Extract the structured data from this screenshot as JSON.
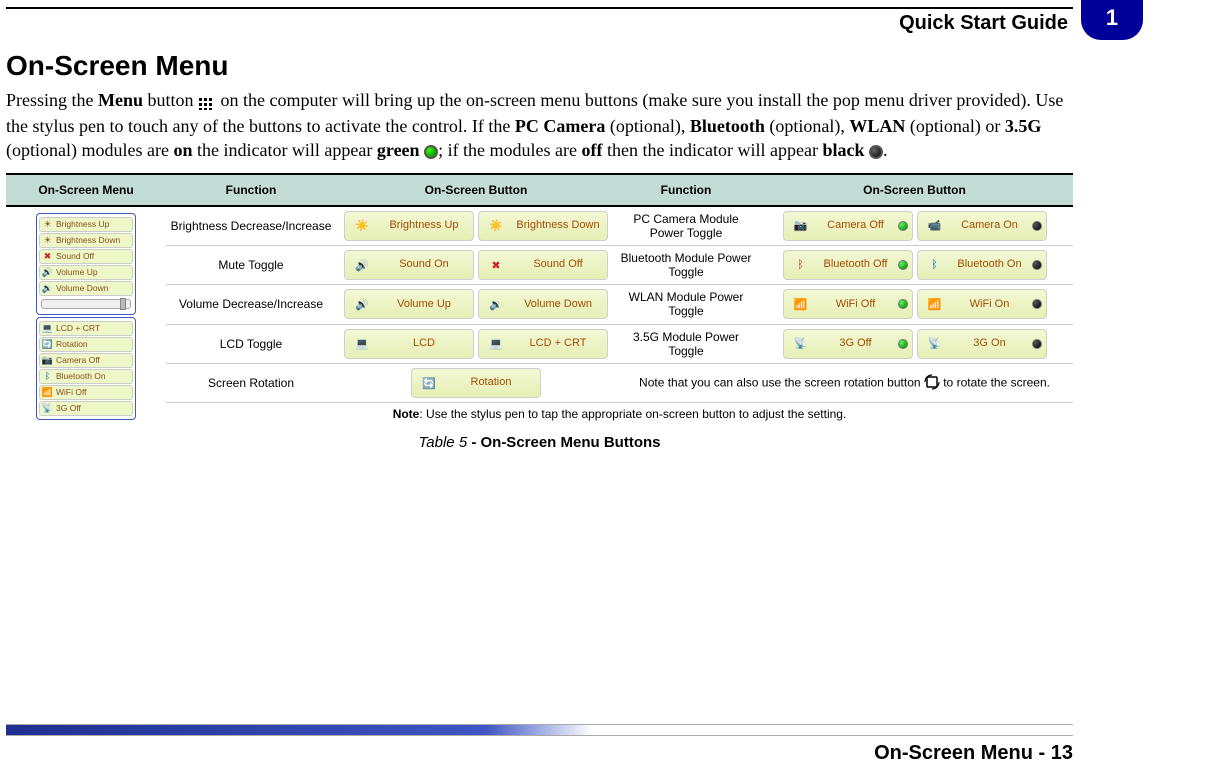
{
  "header": {
    "title": "Quick Start Guide",
    "chapter_num": "1"
  },
  "section": {
    "title": "On-Screen Menu"
  },
  "intro": {
    "pre1": "Pressing the ",
    "menu_word": "Menu",
    "post1": " button ",
    "post_icon": " on the computer will bring up the on-screen menu buttons (make sure you install the pop menu driver provided). Use the stylus pen to touch any of the buttons to activate the control. If the ",
    "pccam": "PC Camera",
    "pccam_opt": " (optional), ",
    "bt": "Bluetooth",
    "bt_opt": " (optional), ",
    "wlan": "WLAN",
    "wlan_opt": " (optional) or ",
    "g35": "3.5G",
    "g35_opt": " (optional) modules are ",
    "on_word": "on",
    "on_post": " the indicator will appear ",
    "green_word": "green",
    "green_post": " ",
    "off_pre": "; if the modules are ",
    "off_word": "off",
    "off_post": " then the indicator will appear ",
    "black_word": "black",
    "black_post": " ",
    "period": "."
  },
  "table": {
    "headers": {
      "c1": "On-Screen Menu",
      "c2": "Function",
      "c3": "On-Screen Button",
      "c4": "Function",
      "c5": "On-Screen Button"
    },
    "rows": [
      {
        "func_left": "Brightness Decrease/Increase",
        "btn_left": [
          "Brightness Up",
          "Brightness Down"
        ],
        "func_right": "PC Camera Module Power Toggle",
        "btn_right": [
          "Camera Off",
          "Camera On"
        ]
      },
      {
        "func_left": "Mute Toggle",
        "btn_left": [
          "Sound On",
          "Sound Off"
        ],
        "func_right": "Bluetooth Module Power Toggle",
        "btn_right": [
          "Bluetooth Off",
          "Bluetooth On"
        ]
      },
      {
        "func_left": "Volume Decrease/Increase",
        "btn_left": [
          "Volume Up",
          "Volume Down"
        ],
        "func_right": "WLAN Module Power Toggle",
        "btn_right": [
          "WiFi Off",
          "WiFi On"
        ]
      },
      {
        "func_left": "LCD Toggle",
        "btn_left": [
          "LCD",
          "LCD + CRT"
        ],
        "func_right": "3.5G Module Power Toggle",
        "btn_right": [
          "3G Off",
          "3G On"
        ]
      },
      {
        "func_left": "Screen Rotation",
        "btn_left_single": "Rotation",
        "rotation_note_pre": "Note that you can also use the screen rotation button ",
        "rotation_note_post": " to rotate the screen."
      }
    ],
    "footer_note_bold": "Note",
    "footer_note_rest": ": Use the stylus pen to tap the appropriate on-screen button to adjust the setting."
  },
  "menu_preview": {
    "group1": [
      "Brightness Up",
      "Brightness Down",
      "Sound Off",
      "Volume Up",
      "Volume Down"
    ],
    "group2": [
      "LCD + CRT",
      "Rotation",
      "Camera Off",
      "Bluetooth On",
      "WiFi Off",
      "3G Off"
    ]
  },
  "caption": {
    "prefix": "Table 5",
    "rest": " - On-Screen Menu Buttons"
  },
  "footer": {
    "text": "On-Screen Menu - 13"
  }
}
